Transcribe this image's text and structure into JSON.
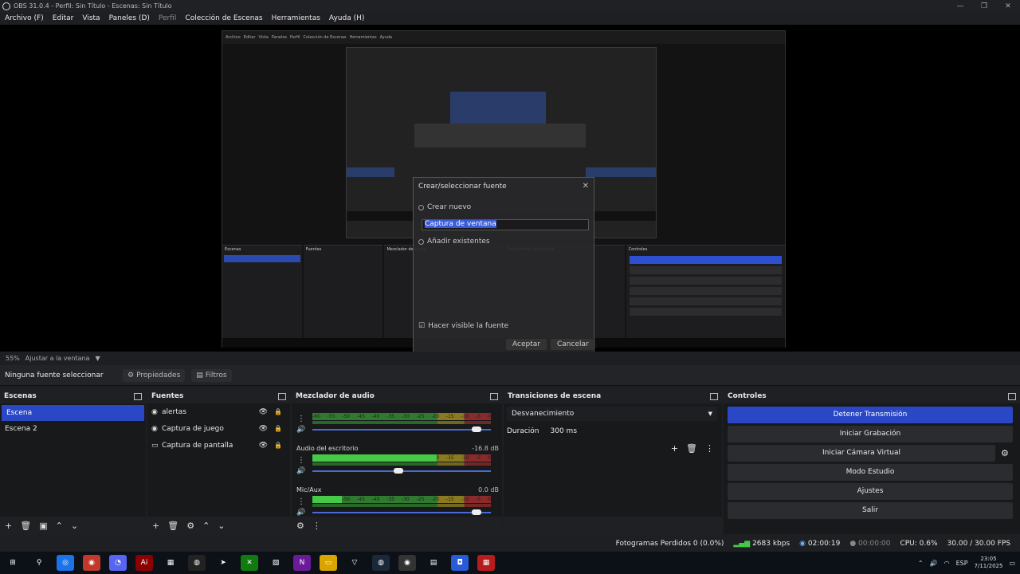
{
  "window": {
    "title": "OBS 31.0.4 - Perfil: Sin Título - Escenas: Sin Título",
    "controls": [
      "—",
      "❐",
      "✕"
    ]
  },
  "menu": {
    "items": [
      "Archivo (F)",
      "Editar",
      "Vista",
      "Paneles (D)",
      "Perfil",
      "Colección de Escenas",
      "Herramientas",
      "Ayuda (H)"
    ]
  },
  "nested_preview": {
    "dialog_title": "Crear/seleccionar fuente",
    "create_new": "Crear nuevo",
    "input_value": "Captura de ventana",
    "add_existing": "Añadir existentes",
    "make_visible": "Hacer visible la fuente",
    "accept": "Aceptar",
    "cancel": "Cancelar"
  },
  "zoom": {
    "level": "55%",
    "mode": "Ajustar a la ventana"
  },
  "source_toolbar": {
    "no_source": "Ninguna fuente seleccionar",
    "properties": "Propiedades",
    "filters": "Filtros"
  },
  "scenes": {
    "title": "Escenas",
    "items": [
      "Escena",
      "Escena 2"
    ]
  },
  "sources": {
    "title": "Fuentes",
    "items": [
      {
        "icon": "gamepad-icon",
        "label": "alertas"
      },
      {
        "icon": "gamepad-icon",
        "label": "Captura de juego"
      },
      {
        "icon": "monitor-icon",
        "label": "Captura de pantalla"
      }
    ]
  },
  "mixer": {
    "title": "Mezclador de audio",
    "channels": [
      {
        "name": "",
        "db": "",
        "level": 0.0,
        "volume": 0.98
      },
      {
        "name": "Audio del escritorio",
        "db": "-16.8 dB",
        "level": 0.72,
        "volume": 0.5
      },
      {
        "name": "Mic/Aux",
        "db": "0.0 dB",
        "level": 0.17,
        "volume": 0.98
      }
    ],
    "ticks": [
      "-60",
      "-55",
      "-50",
      "-45",
      "-40",
      "-35",
      "-30",
      "-25",
      "-20",
      "-15",
      "-10",
      "-5",
      "0"
    ]
  },
  "transitions": {
    "title": "Transiciones de escena",
    "selected": "Desvanecimiento",
    "duration_label": "Duración",
    "duration_value": "300 ms"
  },
  "controls": {
    "title": "Controles",
    "buttons": [
      "Detener Transmisión",
      "Iniciar Grabación",
      "Iniciar Cámara Virtual",
      "Modo Estudio",
      "Ajustes",
      "Salir"
    ]
  },
  "status": {
    "dropped_frames": "Fotogramas Perdidos 0 (0.0%)",
    "bitrate": "2683 kbps",
    "stream_time": "02:00:19",
    "rec_time": "00:00:00",
    "cpu": "CPU: 0.6%",
    "fps": "30.00 / 30.00 FPS"
  },
  "taskbar": {
    "lang": "ESP",
    "time": "23:05",
    "date": "7/11/2025"
  },
  "colors": {
    "accent": "#2a47c5",
    "meter_green": "#46c946"
  }
}
